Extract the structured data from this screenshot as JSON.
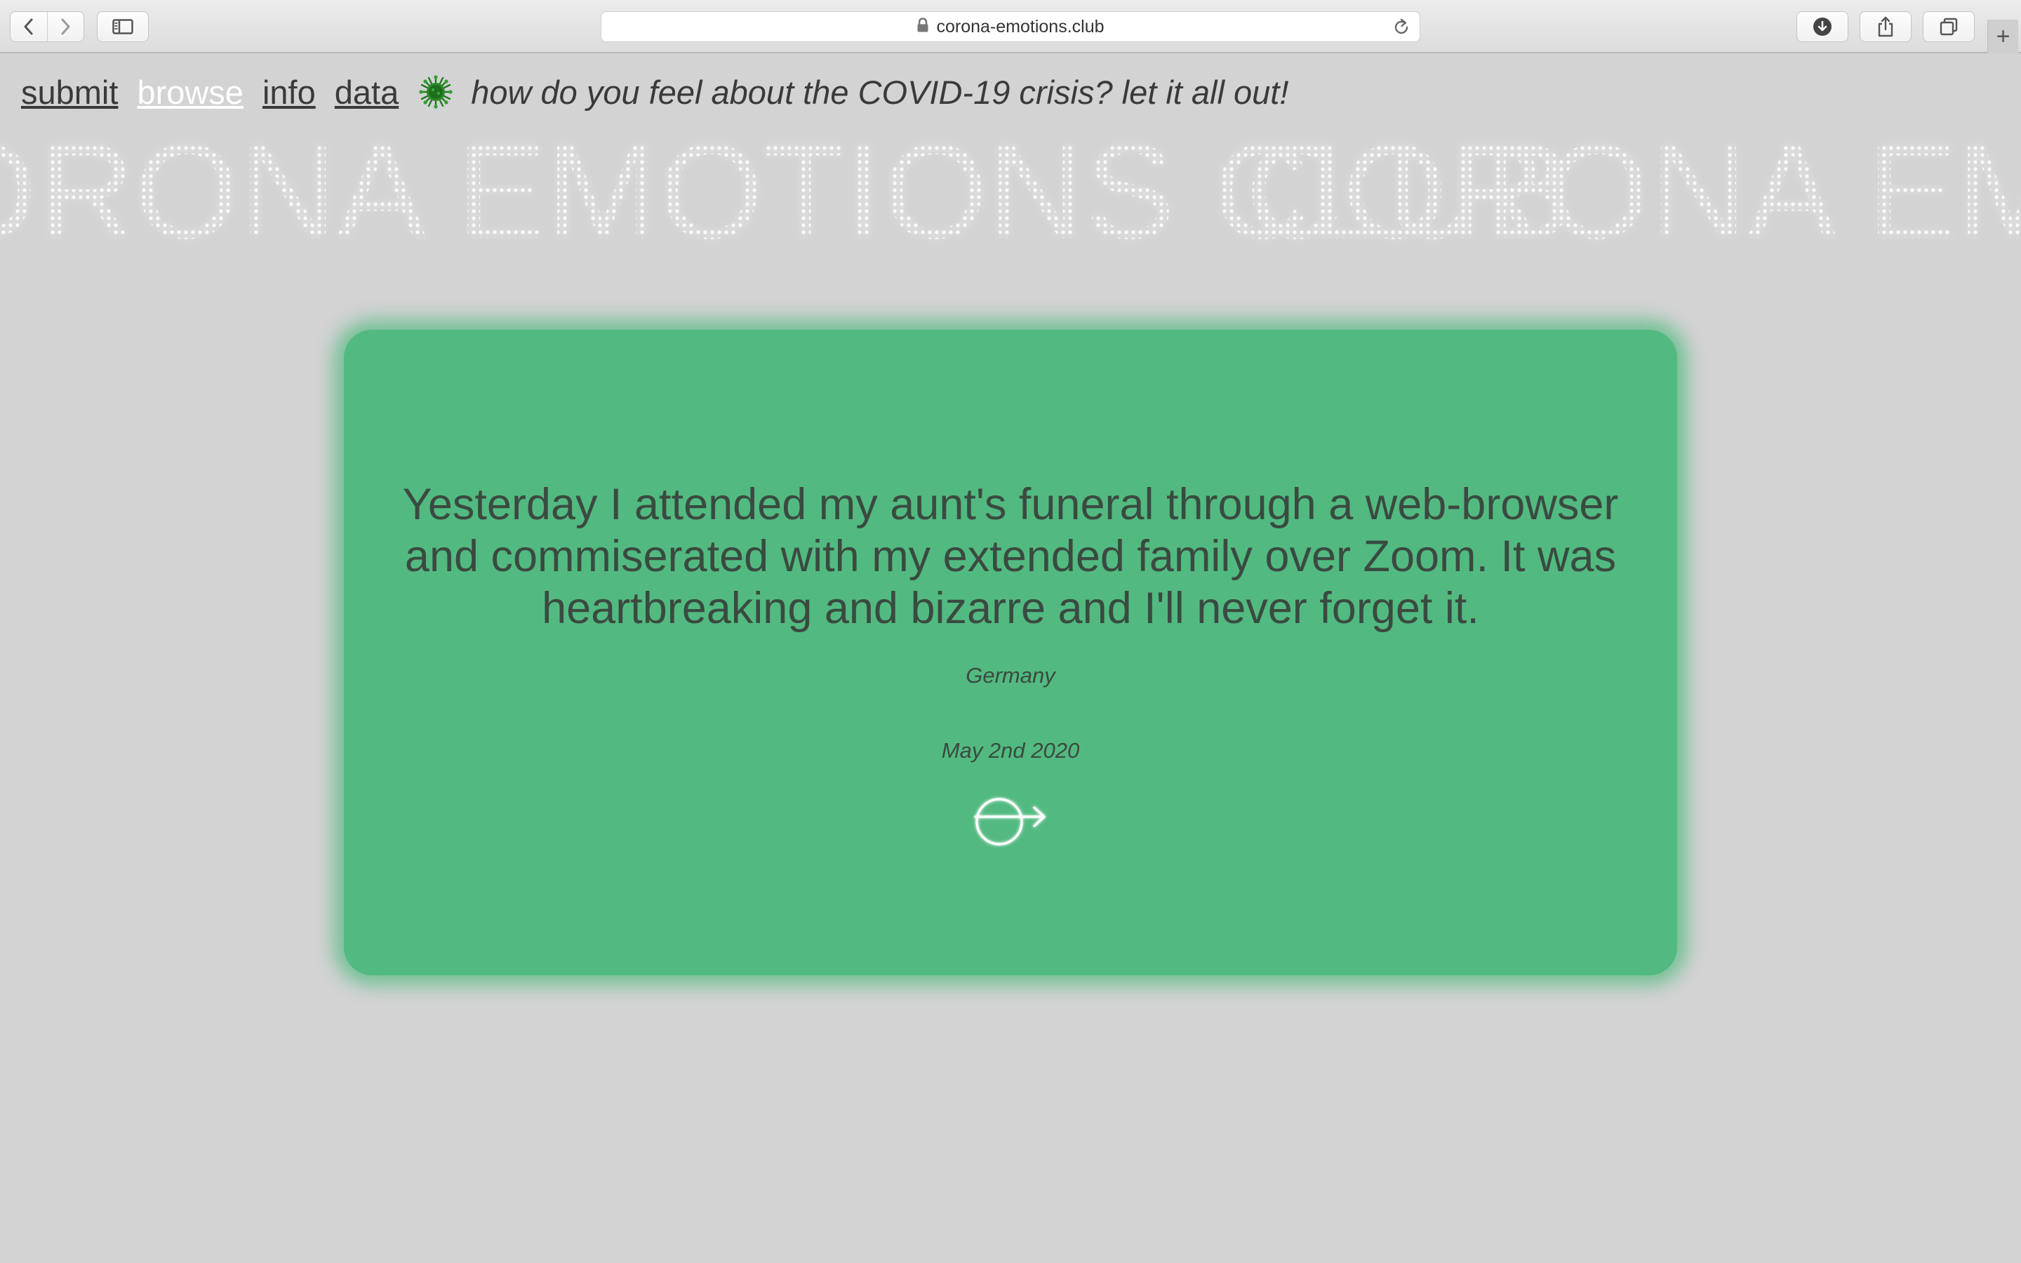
{
  "browser": {
    "url": "corona-emotions.club"
  },
  "nav": {
    "links": [
      "submit",
      "browse",
      "info",
      "data"
    ],
    "active": "browse",
    "tagline": "how do you feel about the COVID-19 crisis? let it all out!"
  },
  "marquee": {
    "text": "CORONA EMOTIONS CLUB"
  },
  "card": {
    "message": "Yesterday I attended my aunt's funeral through a web-browser and commiserated with my extended family over Zoom. It was heartbreaking and bizarre and I'll never forget it.",
    "country": "Germany",
    "date": "May 2nd 2020",
    "color": "#52ba80"
  },
  "icons": {
    "next": "circle-arrow-icon",
    "logo": "virus-icon"
  }
}
